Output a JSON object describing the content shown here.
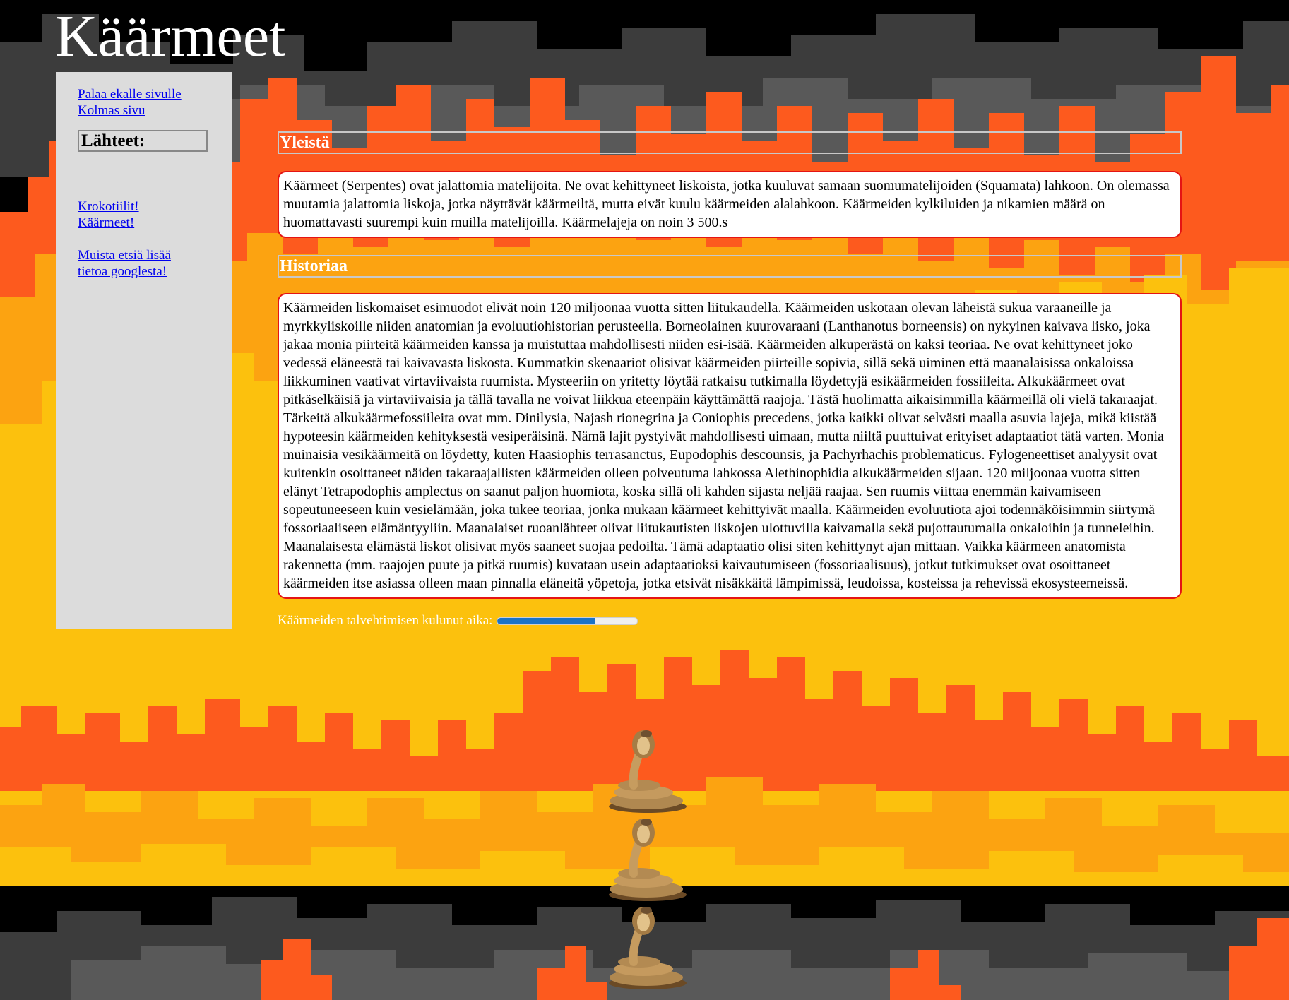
{
  "header": {
    "title": "Käärmeet"
  },
  "sidebar": {
    "links_top": [
      "Palaa ekalle sivulle",
      "Kolmas sivu"
    ],
    "sources_heading": "Lähteet:",
    "links_sources": [
      "Krokotiilit!",
      "Käärmeet!"
    ],
    "google_link": "Muista etsiä lisää tietoa googlesta!"
  },
  "sections": [
    {
      "heading": "Yleistä",
      "text": "Käärmeet (Serpentes) ovat jalattomia matelijoita. Ne ovat kehittyneet liskoista, jotka kuuluvat samaan suomumatelijoiden (Squamata) lahkoon. On olemassa muutamia jalattomia liskoja, jotka näyttävät käärmeiltä, mutta eivät kuulu käärmeiden alalahkoon. Käärmeiden kylkiluiden ja nikamien määrä on huomattavasti suurempi kuin muilla matelijoilla. Käärmelajeja on noin 3 500.s"
    },
    {
      "heading": "Historiaa",
      "text": "Käärmeiden liskomaiset esimuodot elivät noin 120 miljoonaa vuotta sitten liitukaudella. Käärmeiden uskotaan olevan läheistä sukua varaaneille ja myrkkyliskoille niiden anatomian ja evoluutiohistorian perusteella. Borneolainen kuurovaraani (Lanthanotus borneensis) on nykyinen kaivava lisko, joka jakaa monia piirteitä käärmeiden kanssa ja muistuttaa mahdollisesti niiden esi-isää. Käärmeiden alkuperästä on kaksi teoriaa. Ne ovat kehittyneet joko vedessä eläneestä tai kaivavasta liskosta. Kummatkin skenaariot olisivat käärmeiden piirteille sopivia, sillä sekä uiminen että maanalaisissa onkaloissa liikkuminen vaativat virtaviivaista ruumista. Mysteeriin on yritetty löytää ratkaisu tutkimalla löydettyjä esikäärmeiden fossiileita. Alkukäärmeet ovat pitkäselkäisiä ja virtaviivaisia ja tällä tavalla ne voivat liikkua eteenpäin käyttämättä raajoja. Tästä huolimatta aikaisimmilla käärmeillä oli vielä takaraajat. Tärkeitä alkukäärmefossiileita ovat mm. Dinilysia, Najash rionegrina ja Coniophis precedens, jotka kaikki olivat selvästi maalla asuvia lajeja, mikä kiistää hypoteesin käärmeiden kehityksestä vesiperäisinä. Nämä lajit pystyivät mahdollisesti uimaan, mutta niiltä puuttuivat erityiset adaptaatiot tätä varten. Monia muinaisia vesikäärmeitä on löydetty, kuten Haasiophis terrasanctus, Eupodophis descounsis, ja Pachyrhachis problematicus. Fylogeneettiset analyysit ovat kuitenkin osoittaneet näiden takaraajallisten käärmeiden olleen polveutuma lahkossa Alethinophidia alkukäärmeiden sijaan. 120 miljoonaa vuotta sitten elänyt Tetrapodophis amplectus on saanut paljon huomiota, koska sillä oli kahden sijasta neljää raajaa. Sen ruumis viittaa enemmän kaivamiseen sopeutuneeseen kuin vesielämään, joka tukee teoriaa, jonka mukaan käärmeet kehittyivät maalla. Käärmeiden evoluutiota ajoi todennäköisimmin siirtymä fossoriaaliseen elämäntyyliin. Maanalaiset ruoanlähteet olivat liitukautisten liskojen ulottuvilla kaivamalla sekä pujottautumalla onkaloihin ja tunneleihin. Maanalaisesta elämästä liskot olisivat myös saaneet suojaa pedoilta. Tämä adaptaatio olisi siten kehittynyt ajan mittaan. Vaikka käärmeen anatomista rakennetta (mm. raajojen puute ja pitkä ruumis) kuvataan usein adaptaatioksi kaivautumiseen (fossoriaalisuus), jotkut tutkimukset ovat osoittaneet käärmeiden itse asiassa olleen maan pinnalla eläneitä yöpetoja, jotka etsivät nisäkkäitä lämpimissä, leudoissa, kosteissa ja rehevissä ekosysteemeissä."
    }
  ],
  "progress": {
    "label": "Käärmeiden talvehtimisen kulunut aika:",
    "value": 0.7
  },
  "images": {
    "cobra_icon": "cobra-icon",
    "count": 3
  },
  "colors": {
    "fire_yellow": "#fcc10d",
    "fire_amber": "#fca311",
    "fire_orange": "#fd5a1e",
    "smoke_dark": "#3c3c3c",
    "smoke_mid": "#595959",
    "sidebar_bg": "#dcdcdc",
    "box_border": "#e41414",
    "progress_fill": "#1a73c8",
    "link": "#0000ee"
  }
}
